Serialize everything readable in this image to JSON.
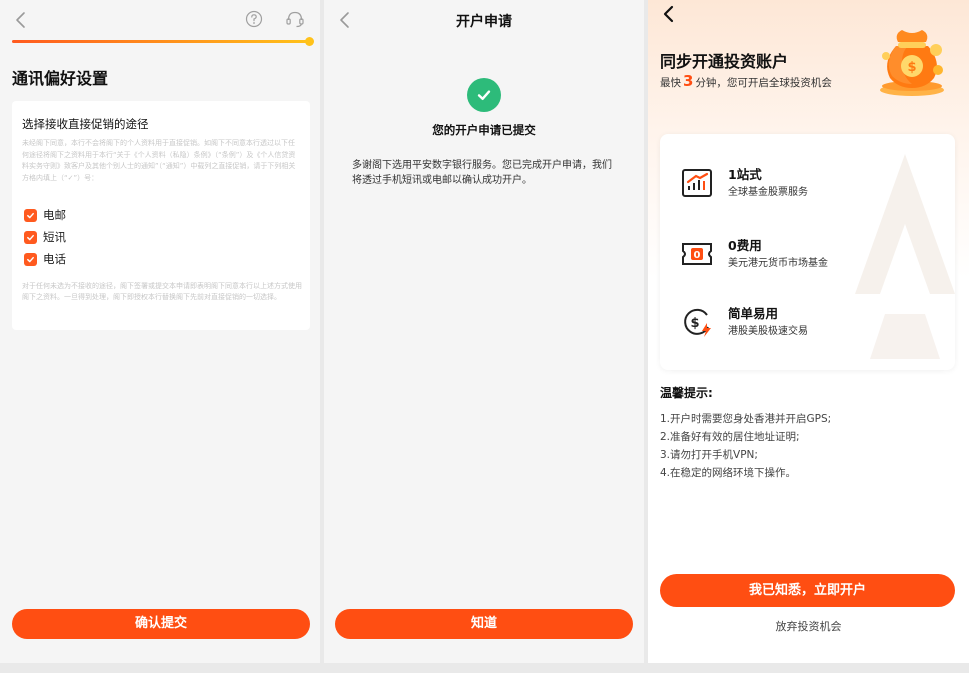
{
  "screen_comm_pref": {
    "title": "通讯偏好设置",
    "progress_fraction": 1.0,
    "card_heading": "选择接收直接促销的途径",
    "card_description": "未经阁下同意，本行不会将阁下的个人资料用于直接促销。如阁下不同意本行透过以下任何途径将阁下之资料用于本行“关于《个人资料（私隐）条例》（“条例”）及《个人信贷资料实务守则》致客户及其他个别人士的通知”（“通知”）中载列之直接促销，请于下列相关方格内填上（“✓”）号：",
    "options": [
      {
        "label": "电邮",
        "checked": true
      },
      {
        "label": "短讯",
        "checked": true
      },
      {
        "label": "电话",
        "checked": true
      }
    ],
    "card_note": "对于任何未选为不接收的途径，阁下签署或提交本申请即表明阁下同意本行以上述方式使用阁下之资料。一旦得到处理，阁下即授权本行替换阁下先前对直接促销的一切选择。",
    "submit_label": "确认提交",
    "icons": {
      "back": "back-chevron-icon",
      "help": "help-icon",
      "service": "customer-service-icon"
    },
    "accent_color": "#ff4e12"
  },
  "screen_submitted": {
    "nav_title": "开户申请",
    "status_heading": "您的开户申请已提交",
    "body_text": "多谢阁下选用平安数字银行服务。您已完成开户申请，我们将透过手机短讯或电邮以确认成功开户。",
    "ok_label": "知道",
    "success_color": "#2dbb7a"
  },
  "screen_invest": {
    "title": "同步开通投资账户",
    "subtitle_prefix": "最快",
    "subtitle_highlight": "3",
    "subtitle_suffix": "分钟，您可开启全球投资机会",
    "features": [
      {
        "title": "1站式",
        "desc": "全球基金股票服务",
        "icon": "chart-icon"
      },
      {
        "title": "0费用",
        "desc": "美元港元货币市场基金",
        "icon": "ticket-icon"
      },
      {
        "title": "简单易用",
        "desc": "港股美股极速交易",
        "icon": "dollar-bolt-icon"
      }
    ],
    "tips_title": "温馨提示:",
    "tips": [
      "1.开户时需要您身处香港并开启GPS;",
      "2.准备好有效的居住地址证明;",
      "3.请勿打开手机VPN;",
      "4.在稳定的网络环境下操作。"
    ],
    "primary_label": "我已知悉，立即开户",
    "secondary_label": "放弃投资机会"
  }
}
